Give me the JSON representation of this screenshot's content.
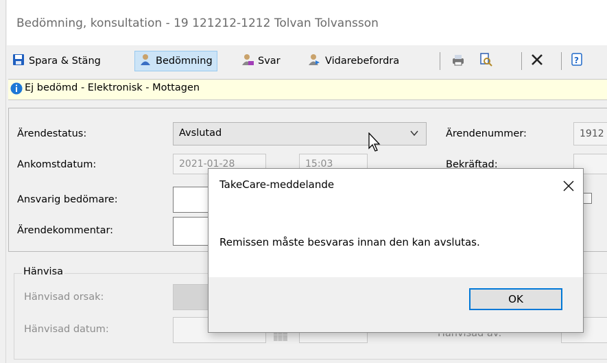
{
  "window": {
    "title": "Bedömning, konsultation  -  19 121212-1212 Tolvan Tolvansson"
  },
  "toolbar": {
    "save_close": "Spara & Stäng",
    "bedomning": "Bedömning",
    "svar": "Svar",
    "vidarebefordra": "Vidarebefordra"
  },
  "infobar": {
    "text": "Ej bedömd  -  Elektronisk  -  Mottagen"
  },
  "form": {
    "arendestatus_label": "Ärendestatus:",
    "arendestatus_value": "Avslutad",
    "ankomstdatum_label": "Ankomstdatum:",
    "ankomst_date_partial": "2021-01-28",
    "ankomst_time_partial": "15:03",
    "ansvarig_label": "Ansvarig bedömare:",
    "kommentar_label": "Ärendekommentar:",
    "arendenummer_label": "Ärendenummer:",
    "arendenummer_value": "1912",
    "bekraftad_partial": "Bekräftad:"
  },
  "hanvisa": {
    "group_label": "Hänvisa",
    "orsak_label": "Hänvisad orsak:",
    "datum_label": "Hänvisad datum:",
    "av_partial": "Hänvisad av:"
  },
  "dialog": {
    "title": "TakeCare-meddelande",
    "message": "Remissen måste besvaras innan den kan avslutas.",
    "ok_label": "OK"
  },
  "icons": {
    "save": "save-icon",
    "user_blue": "user-icon",
    "user_reply": "reply-icon",
    "user_forward": "forward-icon",
    "print": "printer-icon",
    "preview": "print-preview-icon",
    "delete": "close-icon",
    "help": "help-icon",
    "info": "info-icon"
  }
}
